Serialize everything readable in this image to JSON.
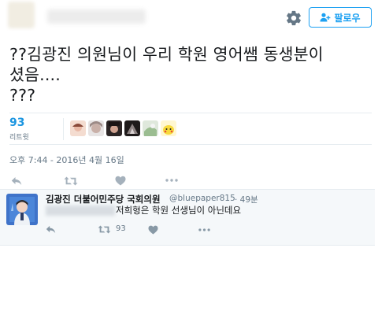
{
  "header": {
    "follow_label": "팔로우",
    "icons": [
      "gear-icon",
      "add-user-icon"
    ]
  },
  "tweet": {
    "text": "??김광진 의원님이 우리 학원 영어쌤 동생분이\n셨음....\n???",
    "retweet_count": "93",
    "retweet_label": "리트윗",
    "timestamp": "오후 7:44 - 2016년 4월 16일",
    "actions": [
      "reply-icon",
      "retweet-icon",
      "like-icon",
      "more-icon"
    ]
  },
  "reply": {
    "name": "김광진 더불어민주당 국회의원",
    "handle": "@bluepaper815",
    "time": "· 49분",
    "text": "저희형은 학원 선생님이 아닌데요",
    "retweet_count": "93",
    "actions": [
      "reply-icon",
      "retweet-icon",
      "like-icon",
      "more-icon"
    ]
  },
  "colors": {
    "accent": "#1da1f2",
    "count": "#1b95e0",
    "muted": "#657786",
    "text": "#14171a",
    "reply_bg": "#f5f8fa"
  }
}
